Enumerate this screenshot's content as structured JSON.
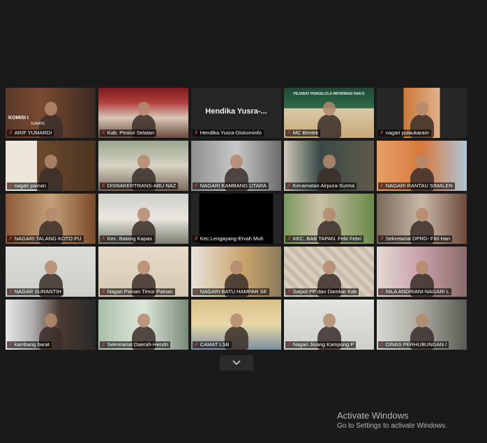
{
  "participants": [
    {
      "name": "ARIF YUMARDI",
      "active": true,
      "scene": "office-wood",
      "overlay": "KOMISI I",
      "overlay2": "SUMATE"
    },
    {
      "name": "Kab. Pesisir Selatan",
      "scene": "meeting-red"
    },
    {
      "name": "Hendika Yusra-Diskominfo",
      "scene": "name-only",
      "display_name": "Hendika  Yusra-..."
    },
    {
      "name": "MC Bimtek",
      "scene": "green-banner",
      "banner": "PEJABAT PENGELOLA INFORMASI DAN D"
    },
    {
      "name": "nagari pulaukaram",
      "scene": "small-orange"
    },
    {
      "name": "nagari painan",
      "scene": "room-cabinet"
    },
    {
      "name": "DISNAKERTRANS-ABU NAZ",
      "scene": "office-light"
    },
    {
      "name": "NAGARI KAMBANG UTARA",
      "scene": "room-grey"
    },
    {
      "name": "Kecamatan Airpura-Surma",
      "scene": "room-teal"
    },
    {
      "name": "NAGARI RANTAU SIMALEN",
      "scene": "room-orange"
    },
    {
      "name": "NAGARI TALANG KOTO PU",
      "scene": "room-wood"
    },
    {
      "name": "Kec. Batang Kapas",
      "scene": "meeting-white"
    },
    {
      "name": "Kec.Lengayang-Ervah Muh",
      "scene": "black"
    },
    {
      "name": "KEC. BAB TAPAN. Febi Febri",
      "scene": "room-green"
    },
    {
      "name": "Sekretariat DPRD- Fitri Han",
      "scene": "room-books"
    },
    {
      "name": "NAGAR  SURANTIH",
      "scene": "room-plain"
    },
    {
      "name": "Nagari Painan Timur Painan",
      "scene": "room-beige"
    },
    {
      "name": "NAGARI BATU HAMPAR SE",
      "scene": "room-wall"
    },
    {
      "name": "Satpol PP dan Damkar Kab",
      "scene": "room-pattern"
    },
    {
      "name": "NILA ANDRIANI-NAGARI L",
      "scene": "room-pink"
    },
    {
      "name": "kambang barat",
      "scene": "closeup"
    },
    {
      "name": "Sekretariat Daerah-Hendri",
      "scene": "room-lightgreen"
    },
    {
      "name": "CAMAT LSB",
      "scene": "room-yellow"
    },
    {
      "name": "Nagari Jinang Kampung P",
      "scene": "room-white"
    },
    {
      "name": "DINAS PERHUBUNGAN /",
      "scene": "room-mask"
    }
  ],
  "controls": {
    "expand_icon": "chevron-down-icon"
  },
  "watermark": {
    "title": "Activate Windows",
    "subtitle": "Go to Settings to activate Windows."
  },
  "colors": {
    "active_border": "#c9d65a",
    "mic_muted": "#e33b3b",
    "background": "#1a1a1a"
  }
}
